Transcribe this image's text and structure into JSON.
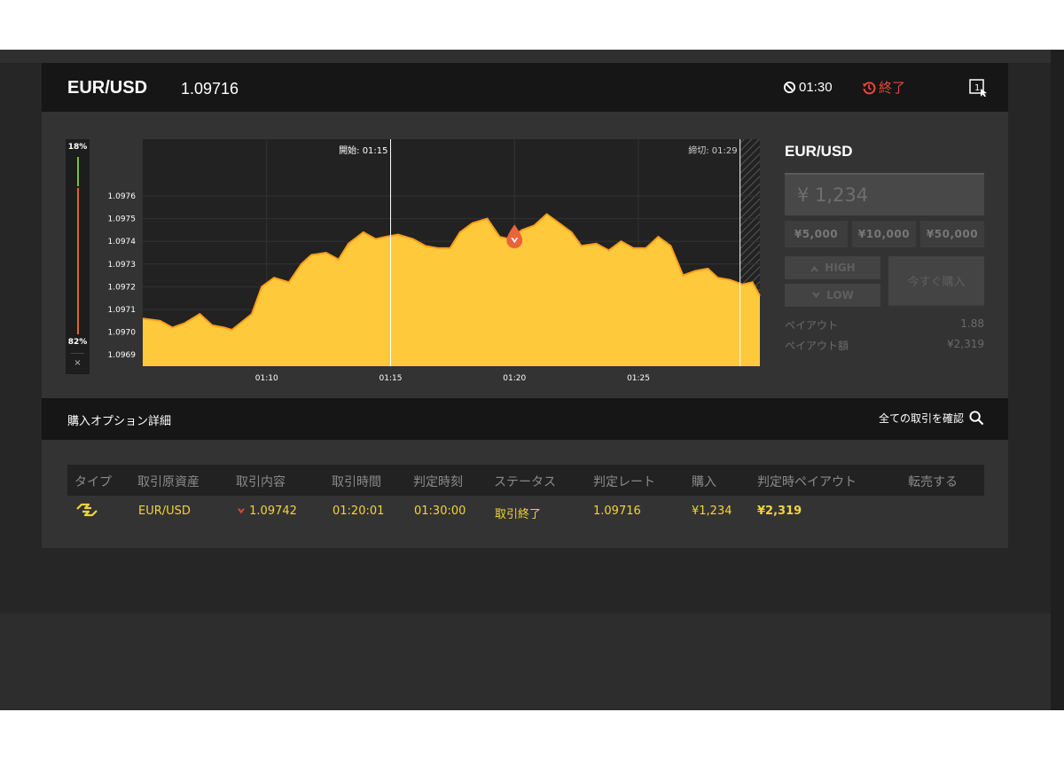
{
  "header": {
    "pair": "EUR/USD",
    "price": "1.09716",
    "timer": "01:30",
    "status": "終了"
  },
  "gauge": {
    "high_pct": "18%",
    "low_pct": "82%",
    "close": "×"
  },
  "chart_data": {
    "type": "area",
    "start_label": "開始: 01:15",
    "end_label": "締切: 01:29",
    "x_ticks": [
      "01:10",
      "01:15",
      "01:20",
      "01:25"
    ],
    "y_ticks": [
      "1.0976",
      "1.0975",
      "1.0974",
      "1.0973",
      "1.0972",
      "1.0971",
      "1.0970",
      "1.0969"
    ],
    "ylim": [
      1.09685,
      1.09785
    ],
    "xlim_minutes": [
      5.0,
      29.9
    ],
    "x_minutes": [
      5.0,
      5.7,
      6.2,
      6.7,
      7.3,
      7.8,
      8.3,
      8.6,
      9.4,
      9.8,
      10.3,
      10.9,
      11.4,
      11.8,
      12.4,
      12.9,
      13.3,
      13.9,
      14.4,
      14.8,
      15.3,
      15.9,
      16.4,
      16.9,
      17.4,
      17.8,
      18.3,
      18.9,
      19.4,
      19.8,
      20.3,
      20.8,
      21.3,
      21.8,
      22.3,
      22.7,
      23.3,
      23.8,
      24.3,
      24.8,
      25.3,
      25.8,
      26.3,
      26.8,
      27.3,
      27.8,
      28.2,
      28.7,
      29.2,
      29.6,
      29.9
    ],
    "values": [
      1.09706,
      1.09705,
      1.09702,
      1.09704,
      1.09708,
      1.09703,
      1.09702,
      1.09701,
      1.09708,
      1.0972,
      1.09724,
      1.09722,
      1.0973,
      1.09734,
      1.09735,
      1.09732,
      1.09739,
      1.09744,
      1.09741,
      1.09742,
      1.09743,
      1.09741,
      1.09738,
      1.09737,
      1.09737,
      1.09744,
      1.09748,
      1.0975,
      1.09742,
      1.09741,
      1.09745,
      1.09747,
      1.09752,
      1.09748,
      1.09744,
      1.09738,
      1.09739,
      1.09736,
      1.0974,
      1.09737,
      1.09737,
      1.09742,
      1.09738,
      1.09725,
      1.09727,
      1.09728,
      1.09724,
      1.09723,
      1.09721,
      1.09722,
      1.09716
    ],
    "entry_x_minutes": 20.0,
    "entry_value": 1.09742,
    "entry_direction": "low",
    "series_color": "#ffc93c"
  },
  "trade": {
    "title": "EUR/USD",
    "amount": "¥ 1,234",
    "presets": [
      "¥5,000",
      "¥10,000",
      "¥50,000"
    ],
    "high_label": "HIGH",
    "low_label": "LOW",
    "buy_now": "今すぐ購入",
    "payout_label": "ペイアウト",
    "payout_value": "1.88",
    "payout_amount_label": "ペイアウト額",
    "payout_amount_value": "¥2,319"
  },
  "details": {
    "title": "購入オプション詳細",
    "link": "全ての取引を確認",
    "columns": [
      "タイプ",
      "取引原資産",
      "取引内容",
      "取引時間",
      "判定時刻",
      "ステータス",
      "判定レート",
      "購入",
      "判定時ペイアウト",
      "転売する"
    ],
    "row": {
      "asset": "EUR/USD",
      "content": "1.09742",
      "trade_time": "01:20:01",
      "judge_time": "01:30:00",
      "status": "取引終了",
      "rate": "1.09716",
      "purchase": "¥1,234",
      "payout": "¥2,319"
    }
  }
}
